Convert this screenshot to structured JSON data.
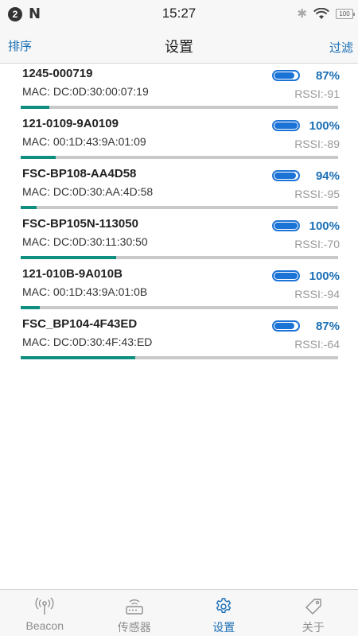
{
  "status_bar": {
    "badge": "2",
    "n_icon": "N",
    "time": "15:27",
    "battery_text": "100"
  },
  "nav": {
    "left": "排序",
    "title": "设置",
    "right": "过滤"
  },
  "devices": [
    {
      "name": "1245-000719",
      "mac": "MAC: DC:0D:30:00:07:19",
      "battery_pct": "87%",
      "battery_level": 0.87,
      "rssi": "RSSI:-91",
      "signal_level": 0.09
    },
    {
      "name": "121-0109-9A0109",
      "mac": "MAC: 00:1D:43:9A:01:09",
      "battery_pct": "100%",
      "battery_level": 1.0,
      "rssi": "RSSI:-89",
      "signal_level": 0.11
    },
    {
      "name": "FSC-BP108-AA4D58",
      "mac": "MAC: DC:0D:30:AA:4D:58",
      "battery_pct": "94%",
      "battery_level": 0.94,
      "rssi": "RSSI:-95",
      "signal_level": 0.05
    },
    {
      "name": "FSC-BP105N-113050",
      "mac": "MAC: DC:0D:30:11:30:50",
      "battery_pct": "100%",
      "battery_level": 1.0,
      "rssi": "RSSI:-70",
      "signal_level": 0.3
    },
    {
      "name": "121-010B-9A010B",
      "mac": "MAC: 00:1D:43:9A:01:0B",
      "battery_pct": "100%",
      "battery_level": 1.0,
      "rssi": "RSSI:-94",
      "signal_level": 0.06
    },
    {
      "name": "FSC_BP104-4F43ED",
      "mac": "MAC: DC:0D:30:4F:43:ED",
      "battery_pct": "87%",
      "battery_level": 0.87,
      "rssi": "RSSI:-64",
      "signal_level": 0.36
    }
  ],
  "tabs": [
    {
      "label": "Beacon",
      "icon": "beacon-icon",
      "active": false
    },
    {
      "label": "传感器",
      "icon": "sensor-icon",
      "active": false
    },
    {
      "label": "设置",
      "icon": "gear-icon",
      "active": true
    },
    {
      "label": "关于",
      "icon": "tag-icon",
      "active": false
    }
  ],
  "colors": {
    "accent": "#1a6fb5",
    "battery": "#1c73d6",
    "signal": "#0f8f80",
    "track": "#c9c9c9"
  }
}
